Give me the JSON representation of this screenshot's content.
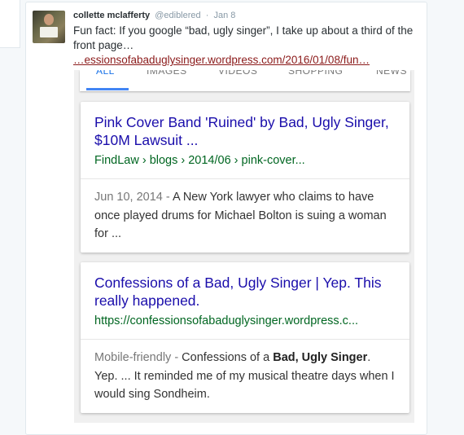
{
  "tweet": {
    "display_name": "collette mclafferty",
    "handle": "@ediblered",
    "separator": "·",
    "date": "Jan 8",
    "text": "Fun fact: If you google “bad, ugly singer”, I take up about a third of the front page…",
    "link": "…essionsofabaduglysinger.wordpress.com/2016/01/08/fun…"
  },
  "search_tabs": [
    "ALL",
    "IMAGES",
    "VIDEOS",
    "SHOPPING",
    "NEWS"
  ],
  "results": [
    {
      "title": "Pink Cover Band 'Ruined' by Bad, Ugly Singer, $10M Lawsuit ...",
      "url": "FindLaw › blogs › 2014/06 › pink-cover...",
      "snippet_prefix": "Jun 10, 2014 - ",
      "snippet": "A New York lawyer who claims to have once played drums for Michael Bolton is suing a woman for ..."
    },
    {
      "title": "Confessions of a Bad, Ugly Singer | Yep. This really happened.",
      "url": "https://confessionsofabaduglysinger.wordpress.c...",
      "snippet_prefix": "Mobile-friendly - ",
      "snippet_part1": "Confessions of a ",
      "snippet_bold1": "Bad, Ugly",
      "snippet_bold2": "Singer",
      "snippet_part2": ". Yep. ... It reminded me of my musical theatre days when I would sing Sondheim."
    }
  ],
  "colors": {
    "result_title": "#1a0dab",
    "result_url": "#006621",
    "tab_active": "#4285f4",
    "tweet_link": "#8b1a1a"
  }
}
